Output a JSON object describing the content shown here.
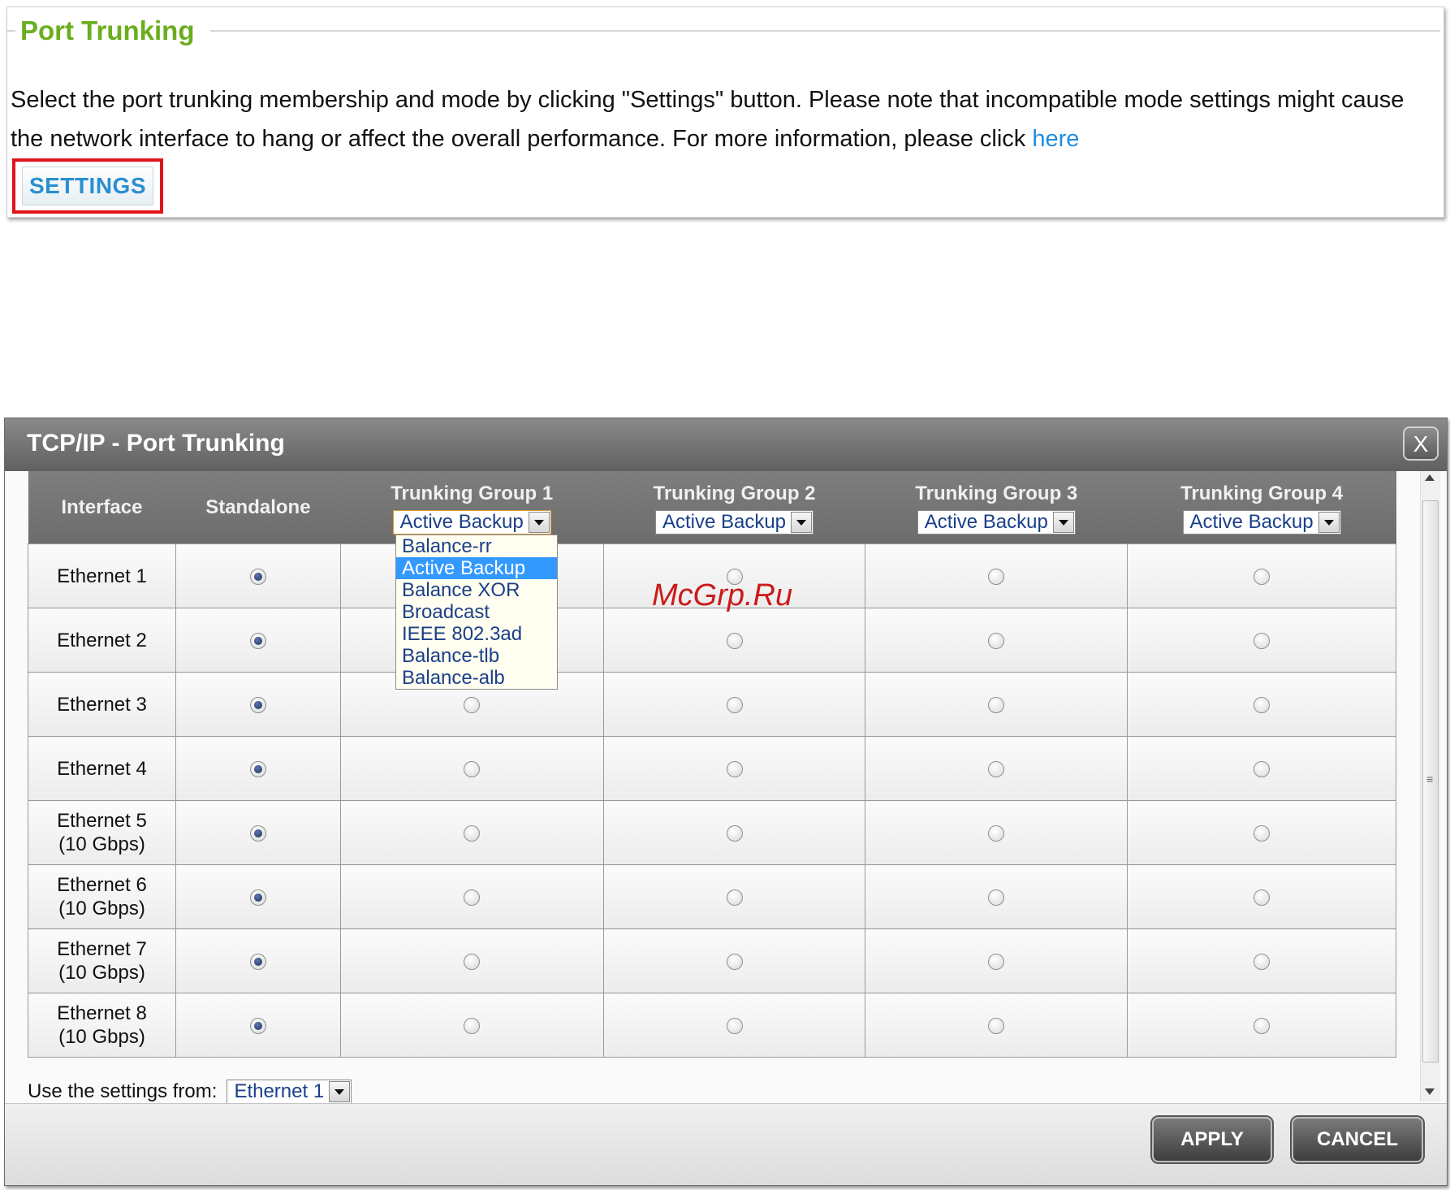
{
  "top_panel": {
    "title": "Port Trunking",
    "description": "Select the port trunking membership and mode by clicking \"Settings\" button. Please note that incompatible mode settings might cause the network interface to hang or affect the overall performance. For more information, please click ",
    "link_text": "here",
    "settings_button": "SETTINGS"
  },
  "dialog": {
    "title": "TCP/IP - Port Trunking",
    "close_label": "X",
    "columns": {
      "interface": "Interface",
      "standalone": "Standalone",
      "groups": [
        {
          "label": "Trunking Group 1",
          "mode": "Active Backup"
        },
        {
          "label": "Trunking Group 2",
          "mode": "Active Backup"
        },
        {
          "label": "Trunking Group 3",
          "mode": "Active Backup"
        },
        {
          "label": "Trunking Group 4",
          "mode": "Active Backup"
        }
      ]
    },
    "rows": [
      {
        "line1": "Ethernet 1",
        "line2": ""
      },
      {
        "line1": "Ethernet 2",
        "line2": ""
      },
      {
        "line1": "Ethernet 3",
        "line2": ""
      },
      {
        "line1": "Ethernet 4",
        "line2": ""
      },
      {
        "line1": "Ethernet 5",
        "line2": "(10 Gbps)"
      },
      {
        "line1": "Ethernet 6",
        "line2": "(10 Gbps)"
      },
      {
        "line1": "Ethernet 7",
        "line2": "(10 Gbps)"
      },
      {
        "line1": "Ethernet 8",
        "line2": "(10 Gbps)"
      }
    ],
    "mode_options": [
      "Balance-rr",
      "Active Backup",
      "Balance XOR",
      "Broadcast",
      "IEEE 802.3ad",
      "Balance-tlb",
      "Balance-alb"
    ],
    "selected_mode_option": "Active Backup",
    "use_settings_label": "Use the settings from:",
    "use_settings_value": "Ethernet 1",
    "apply_button": "APPLY",
    "cancel_button": "CANCEL"
  },
  "watermark": "McGrp.Ru",
  "colors": {
    "title_green": "#6aae1e",
    "link_blue": "#1e8de0",
    "highlight_red": "#e0141b",
    "dropdown_selected": "#3399ff"
  }
}
